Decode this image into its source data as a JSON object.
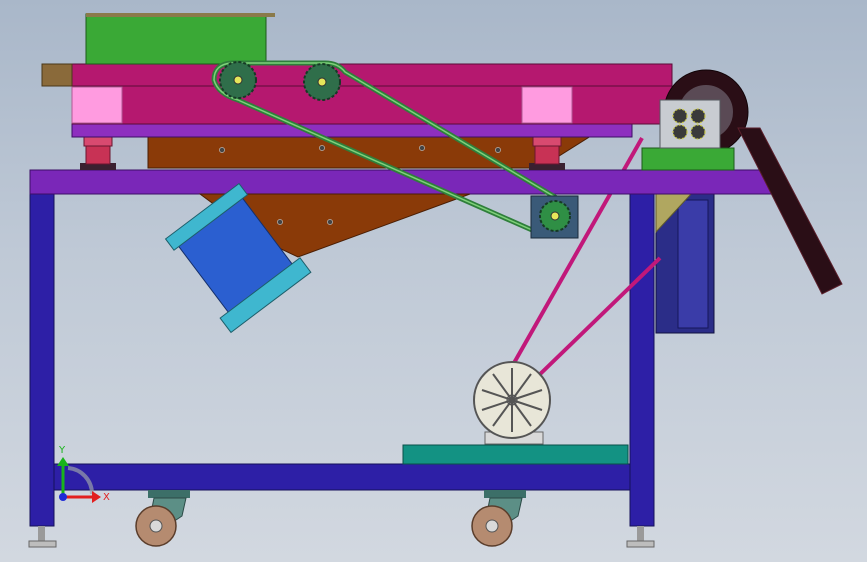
{
  "viewport": {
    "background_top": "#a9b7c9",
    "background_bottom": "#d2d8e0"
  },
  "colors": {
    "frame_blue": "#2d1fa6",
    "table_purple": "#7a27b8",
    "box_magenta": "#b5186f",
    "block_pink": "#ff9be0",
    "hopper_brown": "#8a3a08",
    "feeder_green": "#3aa936",
    "belt_green": "#2f7f3b",
    "chute_blue": "#2b5fd0",
    "chute_cyan": "#3fb7cf",
    "spring_red": "#c83255",
    "drive_belt_magenta": "#c1187a",
    "motor_body": "#e8e6d8",
    "motor_base_teal": "#139283",
    "gearbox_gray": "#c8ccd1",
    "pulley_black": "#2a0e16",
    "wheel_brown": "#b58b70",
    "caster_teal": "#3c6f68",
    "column_navy": "#2b2d88",
    "axis_y_green": "#18b41a",
    "axis_x_red": "#e21f1f"
  },
  "axis": {
    "y_label": "Y",
    "x_label": "X"
  }
}
